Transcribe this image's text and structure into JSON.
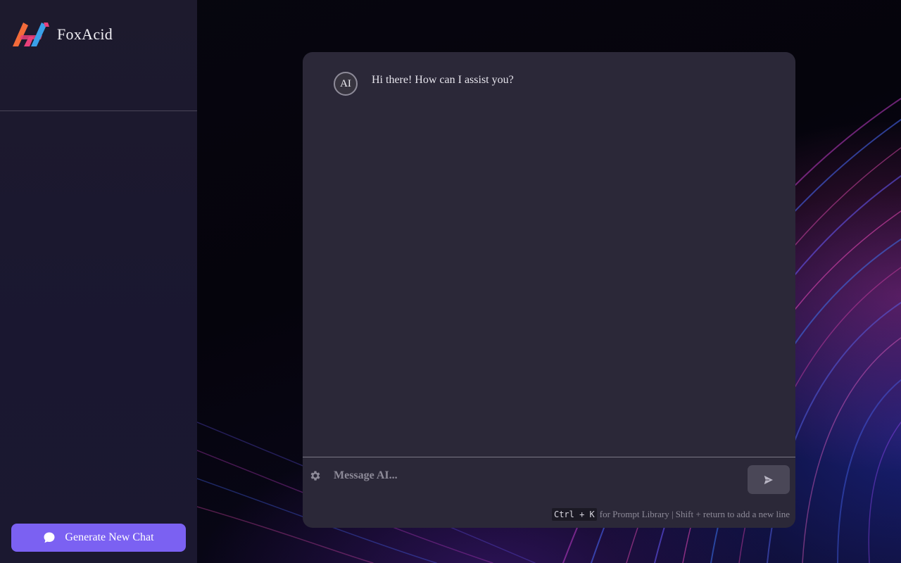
{
  "sidebar": {
    "brand_name": "FoxAcid",
    "new_chat_label": "Generate New Chat"
  },
  "chat": {
    "messages": [
      {
        "sender": "AI",
        "avatar_label": "AI",
        "text": "Hi there! How can I assist you?"
      }
    ],
    "input": {
      "placeholder": "Message AI...",
      "value": ""
    },
    "hint": {
      "shortcut": "Ctrl + K",
      "text": "for Prompt Library | Shift + return to add a new line"
    }
  },
  "icons": {
    "logo": "foxacid-logo-icon",
    "new_chat": "chat-bubble-icon",
    "settings": "gear-icon",
    "send": "send-icon"
  },
  "colors": {
    "accent": "#7b61f2",
    "sidebar_bg": "#1d1a2d",
    "panel_bg": "#2b2838",
    "logo_orange": "#f26b3a",
    "logo_pink": "#e8407a",
    "logo_blue": "#3aa0e8"
  }
}
